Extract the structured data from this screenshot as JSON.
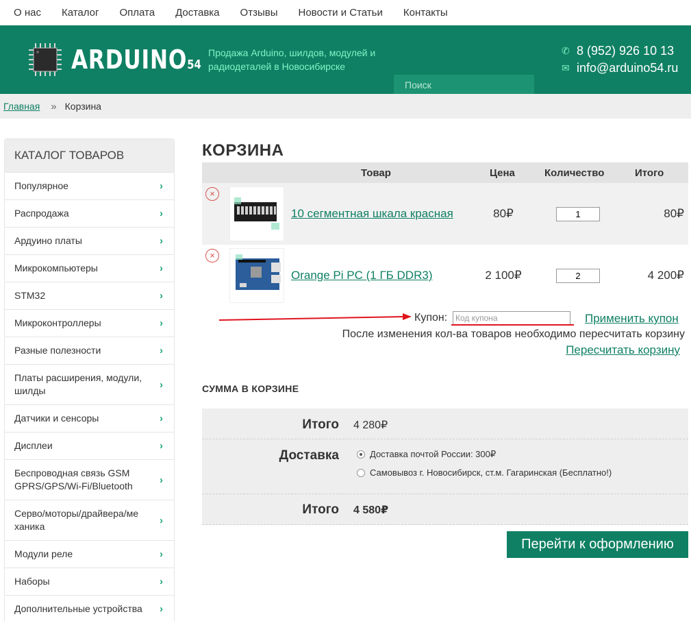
{
  "topnav": [
    "О нас",
    "Каталог",
    "Оплата",
    "Доставка",
    "Отзывы",
    "Новости и Статьи",
    "Контакты"
  ],
  "header": {
    "logo_main": "ARDUINO",
    "logo_suffix": "54",
    "tagline": "Продажа Arduino, шилдов, модулей и радиодеталей в Новосибирске",
    "search_placeholder": "Поиск",
    "phone": "8 (952) 926 10 13",
    "email": "info@arduino54.ru",
    "brand_color": "#0f8063",
    "accent_color": "#7ff5c6"
  },
  "breadcrumb": {
    "home": "Главная",
    "separator": "»",
    "current": "Корзина"
  },
  "sidebar": {
    "title": "КАТАЛОГ ТОВАРОВ",
    "items": [
      "Популярное",
      "Распродажа",
      "Ардуино платы",
      "Микрокомпьютеры",
      "STM32",
      "Микроконтроллеры",
      "Разные полезности",
      "Платы расширения, модули, шилды",
      "Датчики и сенсоры",
      "Дисплеи",
      "Беспроводная связь GSM GPRS/GPS/Wi-Fi/Bluetooth",
      "Серво/моторы/драйвера/механика",
      "Модули реле",
      "Наборы",
      "Дополнительные устройства"
    ]
  },
  "cart": {
    "title": "КОРЗИНА",
    "columns": {
      "product": "Товар",
      "price": "Цена",
      "qty": "Количество",
      "total": "Итого"
    },
    "items": [
      {
        "name": "10 сегментная шкала красная",
        "price": "80₽",
        "qty": "1",
        "total": "80₽",
        "image": "led-bar-image"
      },
      {
        "name": "Orange Pi PC (1 ГБ DDR3)",
        "price": "2 100₽",
        "qty": "2",
        "total": "4 200₽",
        "image": "board-image"
      }
    ],
    "remove_symbol": "×",
    "coupon_label": "Купон:",
    "coupon_placeholder": "Код купона",
    "apply_coupon": "Применить купон",
    "note": "После изменения кол-ва товаров необходимо пересчитать корзину",
    "recalc": "Пересчитать корзину"
  },
  "summary": {
    "title": "СУММА В КОРЗИНЕ",
    "subtotal_label": "Итого",
    "subtotal_value": "4 280₽",
    "delivery_label": "Доставка",
    "delivery_options": [
      {
        "label": "Доставка почтой России: 300₽",
        "selected": true
      },
      {
        "label": "Самовывоз г. Новосибирск, ст.м. Гагаринская (Бесплатно!)",
        "selected": false
      }
    ],
    "total_label": "Итого",
    "total_value": "4 580₽",
    "checkout": "Перейти к оформлению"
  },
  "annotation": {
    "color": "#e0141e",
    "shape": "red-arrow-and-underline"
  }
}
